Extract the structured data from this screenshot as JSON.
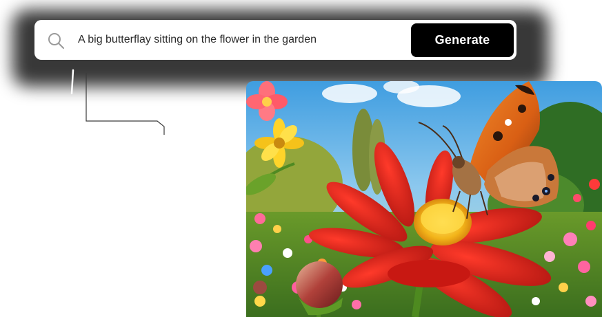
{
  "prompt": {
    "text": "A big butterflay sitting on the flower in the garden",
    "icon": "search-icon"
  },
  "generate_button": {
    "label": "Generate"
  },
  "colors": {
    "button_bg": "#000000",
    "button_text": "#ffffff",
    "bar_bg": "#ffffff",
    "accent_flower": "#d6201b",
    "accent_butterfly": "#e06a1a"
  }
}
